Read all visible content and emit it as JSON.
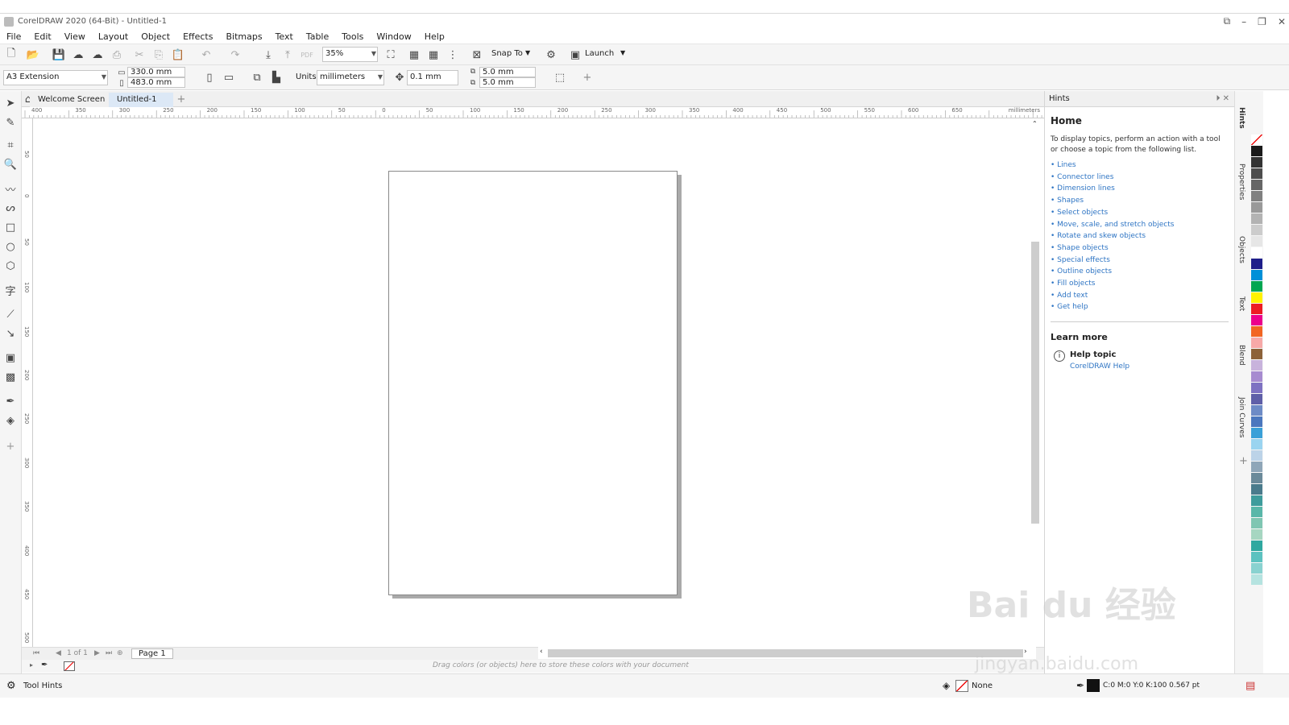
{
  "window": {
    "title": "CorelDRAW 2020 (64-Bit) - Untitled-1"
  },
  "menu": [
    "File",
    "Edit",
    "View",
    "Layout",
    "Object",
    "Effects",
    "Bitmaps",
    "Text",
    "Table",
    "Tools",
    "Window",
    "Help"
  ],
  "toolbar": {
    "zoom": "35%",
    "snap_to": "Snap To",
    "launch": "Launch"
  },
  "propertybar": {
    "page_size": "A3 Extension",
    "width": "330.0 mm",
    "height": "483.0 mm",
    "units_label": "Units:",
    "units": "millimeters",
    "nudge": "0.1 mm",
    "dup_x": "5.0 mm",
    "dup_y": "5.0 mm"
  },
  "tabs": {
    "welcome": "Welcome Screen",
    "doc": "Untitled-1"
  },
  "ruler": {
    "h_labels": [
      "400",
      "350",
      "300",
      "250",
      "200",
      "150",
      "100",
      "50",
      "0",
      "50",
      "100",
      "150",
      "200",
      "250",
      "300",
      "350",
      "400",
      "450",
      "500",
      "550",
      "600",
      "650"
    ],
    "h_unit": "millimeters",
    "v_labels": [
      "50",
      "0",
      "50",
      "100",
      "150",
      "200",
      "250",
      "300",
      "350",
      "400",
      "450",
      "500"
    ]
  },
  "pagenav": {
    "position": "1 of 1",
    "page_tab": "Page 1"
  },
  "colorbar": {
    "hint": "Drag colors (or objects) here to store these colors with your document"
  },
  "status": {
    "tool_hints": "Tool Hints",
    "fill": "None",
    "outline": "C:0 M:0 Y:0 K:100  0.567 pt"
  },
  "hints": {
    "title": "Hints",
    "home": "Home",
    "intro": "To display topics, perform an action with a tool or choose a topic from the following list.",
    "topics": [
      "Lines",
      "Connector lines",
      "Dimension lines",
      "Shapes",
      "Select objects",
      "Move, scale, and stretch objects",
      "Rotate and skew objects",
      "Shape objects",
      "Special effects",
      "Outline objects",
      "Fill objects",
      "Add text",
      "Get help"
    ],
    "learn_more": "Learn more",
    "help_topic": "Help topic",
    "help_link": "CorelDRAW Help"
  },
  "side_tabs": [
    "Hints",
    "Properties",
    "Objects",
    "Text",
    "Blend",
    "Join Curves"
  ],
  "watermark": {
    "text": "Bai du 经验",
    "url": "jingyan.baidu.com"
  },
  "palette_colors": [
    "#ffffff",
    "#1a1a1a",
    "#333333",
    "#4d4d4d",
    "#666666",
    "#808080",
    "#999999",
    "#b3b3b3",
    "#cccccc",
    "#e6e6e6",
    "#ffffff",
    "#1e1e8a",
    "#0090d8",
    "#00a651",
    "#fff200",
    "#ed1c24",
    "#ec008c",
    "#f26522",
    "#f7a9a8",
    "#8c6239",
    "#c8b3dc",
    "#a78bd0",
    "#7e72c2",
    "#5f5fa8",
    "#6d8bc6",
    "#4b77be",
    "#3aa0d8",
    "#9ad4f0",
    "#bcd3e8",
    "#8fa6b8",
    "#6b8a9a",
    "#4a7b8c",
    "#3e9c9c",
    "#59b7a9",
    "#7fc6b2",
    "#a6d6c1",
    "#2fa8a0",
    "#5cc2c0",
    "#89d2d0",
    "#b5e3e0"
  ]
}
